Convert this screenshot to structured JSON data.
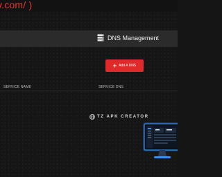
{
  "browser": {
    "url_fragment": "v.com/ )"
  },
  "header": {
    "title": "DNS Management",
    "icon": "database-icon"
  },
  "toolbar": {
    "add_label": "Add A DNS",
    "add_icon": "plus-icon"
  },
  "table": {
    "columns": [
      "SERVICE NAME",
      "SERVICE DNS"
    ]
  },
  "watermark": {
    "text": "TZ APK CREATOR",
    "icon": "globe-icon"
  },
  "colors": {
    "accent": "#e02a2a",
    "background": "#151515",
    "header_bar": "#2b2b2b"
  }
}
